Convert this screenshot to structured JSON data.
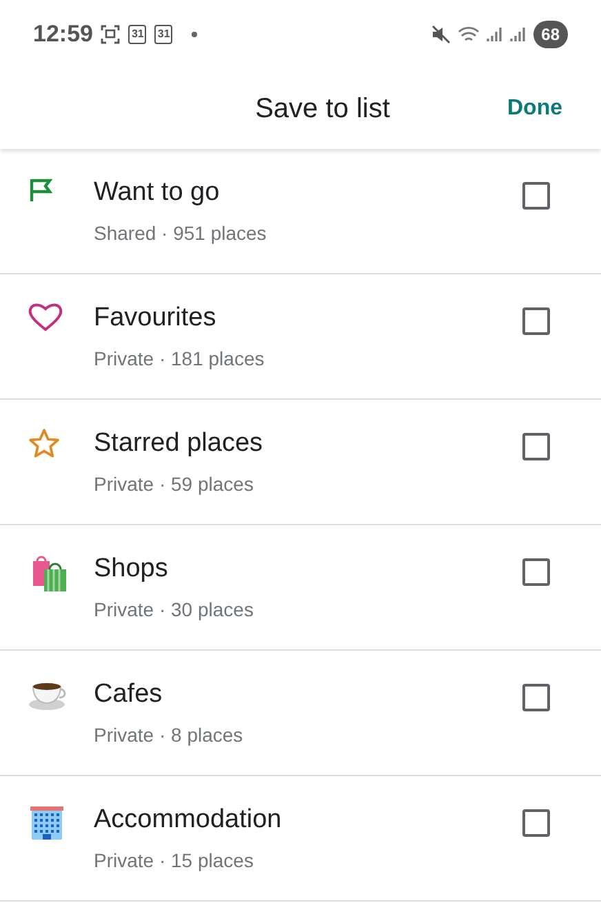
{
  "status_bar": {
    "time": "12:59",
    "calendar_days": [
      "31",
      "31"
    ],
    "battery": "68"
  },
  "header": {
    "title": "Save to list",
    "action": "Done"
  },
  "lists": [
    {
      "kind": "flag",
      "name": "Want to go",
      "detail": "Shared · 951 places",
      "checked": false
    },
    {
      "kind": "heart",
      "name": "Favourites",
      "detail": "Private · 181 places",
      "checked": false
    },
    {
      "kind": "star",
      "name": "Starred places",
      "detail": "Private · 59 places",
      "checked": false
    },
    {
      "kind": "bags",
      "name": "Shops",
      "detail": "Private · 30 places",
      "checked": false
    },
    {
      "kind": "cup",
      "name": "Cafes",
      "detail": "Private · 8 places",
      "checked": false
    },
    {
      "kind": "building",
      "name": "Accommodation",
      "detail": "Private · 15 places",
      "checked": false
    }
  ]
}
